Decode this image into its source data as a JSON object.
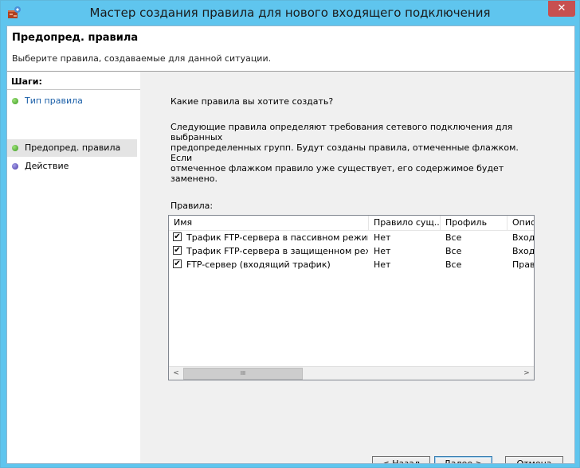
{
  "window": {
    "title": "Мастер создания правила для нового входящего подключения",
    "close_symbol": "✕"
  },
  "header": {
    "title": "Предопред. правила",
    "subtitle": "Выберите правила, создаваемые для данной ситуации."
  },
  "steps": {
    "title": "Шаги:",
    "items": [
      {
        "label": "Тип правила",
        "state": "done"
      },
      {
        "label": "Предопред. правила",
        "state": "current"
      },
      {
        "label": "Действие",
        "state": "pending"
      }
    ]
  },
  "content": {
    "question": "Какие правила вы хотите создать?",
    "description_lines": [
      "Следующие правила определяют требования сетевого подключения для выбранных",
      "предопределенных групп. Будут созданы правила, отмеченные флажком. Если",
      "отмеченное флажком правило уже существует, его содержимое будет заменено."
    ],
    "rules_label": "Правила:"
  },
  "rules_table": {
    "columns": [
      "Имя",
      "Правило сущ...",
      "Профиль",
      "Опис"
    ],
    "rows": [
      {
        "checked": true,
        "check_mark": "✔",
        "name": "Трафик FTP-сервера в пассивном режим...",
        "exists": "Нет",
        "profile": "Все",
        "desc": "Вход"
      },
      {
        "checked": true,
        "check_mark": "✔",
        "name": "Трафик FTP-сервера в защищенном режи...",
        "exists": "Нет",
        "profile": "Все",
        "desc": "Вход"
      },
      {
        "checked": true,
        "check_mark": "✔",
        "name": "FTP-сервер (входящий трафик)",
        "exists": "Нет",
        "profile": "Все",
        "desc": "Прав"
      }
    ],
    "scroll": {
      "left": "<",
      "right": ">",
      "thumb": "III"
    }
  },
  "buttons": {
    "back": "< Назад",
    "next": "Далее >",
    "cancel": "Отмена"
  },
  "colors": {
    "titlebar": "#5fc5ee",
    "close": "#c75050",
    "step_done": "#3a9a20",
    "step_pending": "#4a3aa8"
  }
}
